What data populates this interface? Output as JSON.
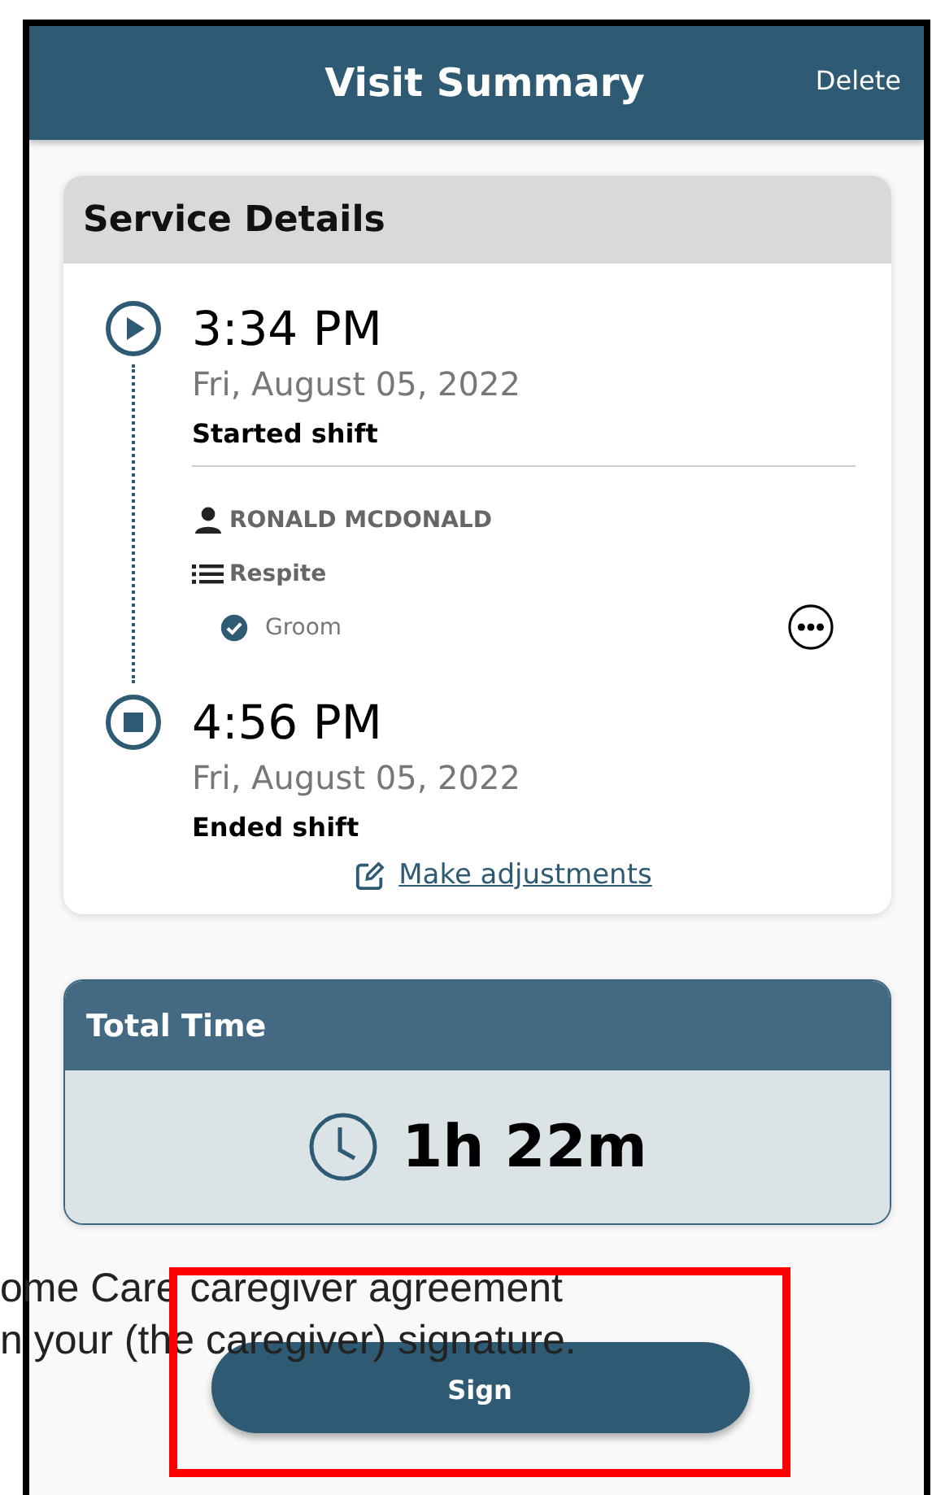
{
  "header": {
    "title": "Visit Summary",
    "action": "Delete"
  },
  "service_details": {
    "title": "Service Details",
    "events": [
      {
        "kind": "start",
        "time": "3:34 PM",
        "date": "Fri, August 05, 2022",
        "label": "Started shift"
      },
      {
        "kind": "end",
        "time": "4:56 PM",
        "date": "Fri, August 05, 2022",
        "label": "Ended shift"
      }
    ],
    "client": "RONALD MCDONALD",
    "service": "Respite",
    "tasks": [
      {
        "name": "Groom",
        "checked": true
      }
    ],
    "adjust_link": "Make adjustments"
  },
  "total_time": {
    "title": "Total Time",
    "value": "1h 22m"
  },
  "agreement_lines": [
    "ome Care caregiver agreement",
    "n your (the caregiver) signature."
  ],
  "sign_button": "Sign",
  "annotation": {
    "kind": "highlight"
  }
}
